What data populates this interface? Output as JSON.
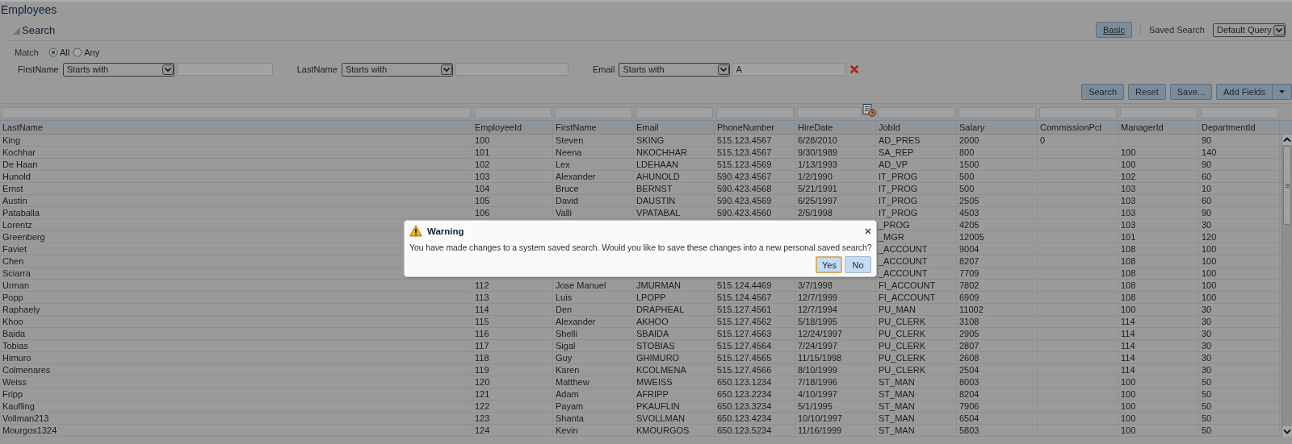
{
  "page_title": "Employees",
  "search": {
    "title": "Search",
    "expanded": true,
    "mode_button": "Basic",
    "saved_search_label": "Saved Search",
    "saved_search_value": "Default Query",
    "match": {
      "label": "Match",
      "options": [
        {
          "label": "All",
          "selected": true
        },
        {
          "label": "Any",
          "selected": false
        }
      ]
    },
    "criteria": [
      {
        "label": "FirstName",
        "operator": "Starts with",
        "removable": false
      },
      {
        "label": "LastName",
        "operator": "Starts with",
        "removable": false
      },
      {
        "label": "Email",
        "operator": "Starts with",
        "value": "A",
        "removable": true
      }
    ],
    "buttons": [
      {
        "label": "Search",
        "kind": "plain"
      },
      {
        "label": "Reset",
        "kind": "plain"
      },
      {
        "label": "Save...",
        "kind": "plain"
      },
      {
        "label": "Add Fields",
        "kind": "menu"
      }
    ]
  },
  "table": {
    "columns": [
      {
        "label": "LastName",
        "kind": "text"
      },
      {
        "label": "EmployeeId",
        "kind": "text"
      },
      {
        "label": "FirstName",
        "kind": "text"
      },
      {
        "label": "Email",
        "kind": "text"
      },
      {
        "label": "PhoneNumber",
        "kind": "text"
      },
      {
        "label": "HireDate",
        "kind": "date"
      },
      {
        "label": "JobId",
        "kind": "text"
      },
      {
        "label": "Salary",
        "kind": "text"
      },
      {
        "label": "CommissionPct",
        "kind": "text"
      },
      {
        "label": "ManagerId",
        "kind": "text"
      },
      {
        "label": "DepartmentId",
        "kind": "text"
      }
    ],
    "rows": [
      [
        "King",
        "100",
        "Steven",
        "SKING",
        "515.123.4567",
        "6/28/2010",
        "AD_PRES",
        "2000",
        "0",
        null,
        "90"
      ],
      [
        "Kochhar",
        "101",
        "Neena",
        "NKOCHHAR",
        "515.123.4567",
        "9/30/1989",
        "SA_REP",
        "800",
        null,
        "100",
        "140"
      ],
      [
        "De Haan",
        "102",
        "Lex",
        "LDEHAAN",
        "515.123.4569",
        "1/13/1993",
        "AD_VP",
        "1500",
        null,
        "100",
        "90"
      ],
      [
        "Hunold",
        "103",
        "Alexander",
        "AHUNOLD",
        "590.423.4567",
        "1/2/1990",
        "IT_PROG",
        "500",
        null,
        "102",
        "60"
      ],
      [
        "Ernst",
        "104",
        "Bruce",
        "BERNST",
        "590.423.4568",
        "5/21/1991",
        "IT_PROG",
        "500",
        null,
        "103",
        "10"
      ],
      [
        "Austin",
        "105",
        "David",
        "DAUSTIN",
        "590.423.4569",
        "6/25/1997",
        "IT_PROG",
        "2505",
        null,
        "103",
        "60"
      ],
      [
        "Pataballa",
        "106",
        "Valli",
        "VPATABAL",
        "590.423.4560",
        "2/5/1998",
        "IT_PROG",
        "4503",
        null,
        "103",
        "90"
      ],
      [
        "Lorentz",
        null,
        null,
        null,
        null,
        null,
        "_PROG",
        "4205",
        null,
        "103",
        "30"
      ],
      [
        "Greenberg",
        null,
        null,
        null,
        null,
        null,
        "_MGR",
        "12005",
        null,
        "101",
        "120"
      ],
      [
        "Faviet",
        null,
        null,
        null,
        null,
        null,
        "_ACCOUNT",
        "9004",
        null,
        "108",
        "100"
      ],
      [
        "Chen",
        null,
        null,
        null,
        null,
        null,
        "_ACCOUNT",
        "8207",
        null,
        "108",
        "100"
      ],
      [
        "Sciarra",
        null,
        null,
        null,
        null,
        null,
        "_ACCOUNT",
        "7709",
        null,
        "108",
        "100"
      ],
      [
        "Urman",
        "112",
        "Jose Manuel",
        "JMURMAN",
        "515.124.4469",
        "3/7/1998",
        "FI_ACCOUNT",
        "7802",
        null,
        "108",
        "100"
      ],
      [
        "Popp",
        "113",
        "Luis",
        "LPOPP",
        "515.124.4567",
        "12/7/1999",
        "FI_ACCOUNT",
        "6909",
        null,
        "108",
        "100"
      ],
      [
        "Raphaely",
        "114",
        "Den",
        "DRAPHEAL",
        "515.127.4561",
        "12/7/1994",
        "PU_MAN",
        "11002",
        null,
        "100",
        "30"
      ],
      [
        "Khoo",
        "115",
        "Alexander",
        "AKHOO",
        "515.127.4562",
        "5/18/1995",
        "PU_CLERK",
        "3108",
        null,
        "114",
        "30"
      ],
      [
        "Baida",
        "116",
        "Shelli",
        "SBAIDA",
        "515.127.4563",
        "12/24/1997",
        "PU_CLERK",
        "2905",
        null,
        "114",
        "30"
      ],
      [
        "Tobias",
        "117",
        "Sigal",
        "STOBIAS",
        "515.127.4564",
        "7/24/1997",
        "PU_CLERK",
        "2807",
        null,
        "114",
        "30"
      ],
      [
        "Himuro",
        "118",
        "Guy",
        "GHIMURO",
        "515.127.4565",
        "11/15/1998",
        "PU_CLERK",
        "2608",
        null,
        "114",
        "30"
      ],
      [
        "Colmenares",
        "119",
        "Karen",
        "KCOLMENA",
        "515.127.4566",
        "8/10/1999",
        "PU_CLERK",
        "2504",
        null,
        "114",
        "30"
      ],
      [
        "Weiss",
        "120",
        "Matthew",
        "MWEISS",
        "650.123.1234",
        "7/18/1996",
        "ST_MAN",
        "8003",
        null,
        "100",
        "50"
      ],
      [
        "Fripp",
        "121",
        "Adam",
        "AFRIPP",
        "650.123.2234",
        "4/10/1997",
        "ST_MAN",
        "8204",
        null,
        "100",
        "50"
      ],
      [
        "Kaufling",
        "122",
        "Payam",
        "PKAUFLIN",
        "650.123.3234",
        "5/1/1995",
        "ST_MAN",
        "7906",
        null,
        "100",
        "50"
      ],
      [
        "Vollman213",
        "123",
        "Shanta",
        "SVOLLMAN",
        "650.123.4234",
        "10/10/1997",
        "ST_MAN",
        "6504",
        null,
        "100",
        "50"
      ],
      [
        "Mourgos1324",
        "124",
        "Kevin",
        "KMOURGOS",
        "650.123.5234",
        "11/16/1999",
        "ST_MAN",
        "5803",
        null,
        "100",
        "50"
      ]
    ]
  },
  "dialog": {
    "title": "Warning",
    "message": "You have made changes to a system saved search. Would you like to save these changes into a new personal saved search?",
    "buttons": [
      {
        "label": "Yes",
        "focused": true
      },
      {
        "label": "No",
        "focused": false
      }
    ]
  }
}
